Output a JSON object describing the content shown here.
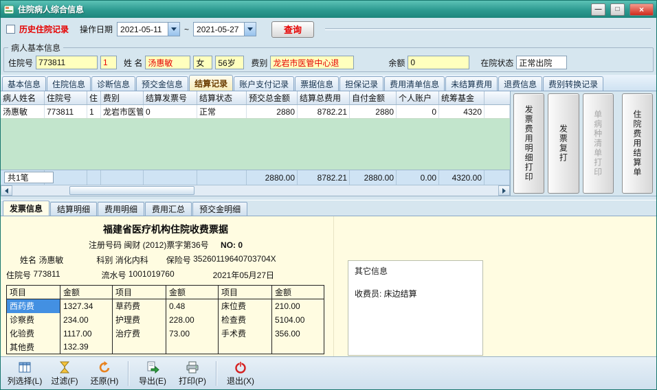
{
  "window": {
    "title": "住院病人综合信息",
    "controls": {
      "minimize": "—",
      "maximize": "□",
      "close": "×"
    }
  },
  "query": {
    "history_label": "历史住院记录",
    "date_label": "操作日期",
    "date_from": "2021-05-11",
    "range_separator": "~",
    "date_to": "2021-05-27",
    "search_button": "查询"
  },
  "patient": {
    "group_title": "病人基本信息",
    "admission_label": "住院号",
    "admission_no": "773811",
    "visit_count": "1",
    "name_label": "姓 名",
    "name": "汤惠敏",
    "gender": "女",
    "age": "56岁",
    "fee_label": "费别",
    "fee_type": "龙岩市医管中心退",
    "balance_label": "余额",
    "balance": "0",
    "status_label": "在院状态",
    "status": "正常出院"
  },
  "main_tabs": [
    "基本信息",
    "住院信息",
    "诊断信息",
    "预交金信息",
    "结算记录",
    "账户支付记录",
    "票据信息",
    "担保记录",
    "费用清单信息",
    "未结算费用",
    "退费信息",
    "费别转换记录"
  ],
  "grid": {
    "columns": [
      "病人姓名",
      "住院号",
      "住",
      "费别",
      "结算发票号",
      "结算状态",
      "预交总金额",
      "结算总费用",
      "自付金额",
      "个人账户",
      "统筹基金"
    ],
    "row": [
      "汤惠敏",
      "773811",
      "1",
      "龙岩市医管中心",
      "0",
      "正常",
      "2880",
      "8782.21",
      "2880",
      "0",
      "4320"
    ],
    "summary_label": "共1笔",
    "totals": [
      "2880.00",
      "8782.21",
      "2880.00",
      "0.00",
      "4320.00"
    ]
  },
  "side_buttons": [
    {
      "label": "发票费用明细打印",
      "disabled": false
    },
    {
      "label": "发票复打",
      "disabled": false
    },
    {
      "label": "单病种清单打印",
      "disabled": true
    },
    {
      "label": "住院费用结算单",
      "disabled": false
    }
  ],
  "detail_tabs": [
    "发票信息",
    "结算明细",
    "费用明细",
    "费用汇总",
    "预交金明细"
  ],
  "invoice": {
    "title": "福建省医疗机构住院收费票据",
    "reg_label": "注册号码",
    "reg_value": "闽财 (2012)票字第36号",
    "no_text": "NO: 0",
    "name_label": "姓名",
    "name": "汤惠敏",
    "dept_label": "科别",
    "dept": "消化内科",
    "insurance_label": "保险号",
    "insurance_no": "35260119640703704X",
    "admission_label": "住院号",
    "admission_no": "773811",
    "serial_label": "流水号",
    "serial_no": "1001019760",
    "date": "2021年05月27日",
    "col_item": "项目",
    "col_amount": "金额",
    "rows": [
      [
        {
          "item": "西药费",
          "amount": "1327.34"
        },
        {
          "item": "草药费",
          "amount": "0.48"
        },
        {
          "item": "床位费",
          "amount": "210.00"
        }
      ],
      [
        {
          "item": "诊察费",
          "amount": "234.00"
        },
        {
          "item": "护理费",
          "amount": "228.00"
        },
        {
          "item": "检查费",
          "amount": "5104.00"
        }
      ],
      [
        {
          "item": "化验费",
          "amount": "1117.00"
        },
        {
          "item": "治疗费",
          "amount": "73.00"
        },
        {
          "item": "手术费",
          "amount": "356.00"
        }
      ],
      [
        {
          "item": "其他费",
          "amount": "132.39"
        },
        {
          "item": "",
          "amount": ""
        },
        {
          "item": "",
          "amount": ""
        }
      ]
    ],
    "other_info_title": "其它信息",
    "cashier_text": "收费员: 床边结算"
  },
  "toolbar": {
    "items": [
      {
        "label": "列选择(L)"
      },
      {
        "label": "过滤(F)"
      },
      {
        "label": "还原(H)"
      },
      {
        "label": "导出(E)"
      },
      {
        "label": "打印(P)"
      },
      {
        "label": "退出(X)"
      }
    ]
  },
  "colors": {
    "titlebar_teal": "#2d9a90",
    "field_yellow": "#ffffbe",
    "highlight_red": "#e60000",
    "grid_green": "#c2e5cc",
    "selected_cell_blue": "#4390e2",
    "invoice_bg": "#fffce1"
  }
}
